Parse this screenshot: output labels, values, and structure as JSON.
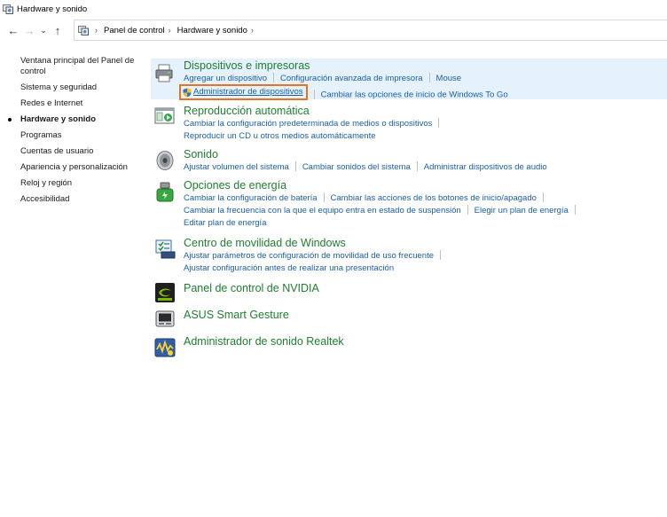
{
  "window": {
    "title": "Hardware y sonido"
  },
  "breadcrumb": [
    "Panel de control",
    "Hardware y sonido"
  ],
  "leftnav": {
    "items": [
      {
        "label": "Ventana principal del Panel de control",
        "current": false
      },
      {
        "label": "Sistema y seguridad",
        "current": false
      },
      {
        "label": "Redes e Internet",
        "current": false
      },
      {
        "label": "Hardware y sonido",
        "current": true
      },
      {
        "label": "Programas",
        "current": false
      },
      {
        "label": "Cuentas de usuario",
        "current": false
      },
      {
        "label": "Apariencia y personalización",
        "current": false
      },
      {
        "label": "Reloj y región",
        "current": false
      },
      {
        "label": "Accesibilidad",
        "current": false
      }
    ]
  },
  "categories": [
    {
      "title": "Dispositivos e impresoras",
      "icon": "printer-icon",
      "rows": [
        [
          "Agregar un dispositivo",
          "Configuración avanzada de impresora",
          "Mouse"
        ],
        [
          "Administrador de dispositivos",
          "Cambiar las opciones de inicio de Windows To Go"
        ]
      ]
    },
    {
      "title": "Reproducción automática",
      "icon": "autoplay-icon",
      "rows": [
        [
          "Cambiar la configuración predeterminada de medios o dispositivos"
        ],
        [
          "Reproducir un CD u otros medios automáticamente"
        ]
      ]
    },
    {
      "title": "Sonido",
      "icon": "speaker-icon",
      "rows": [
        [
          "Ajustar volumen del sistema",
          "Cambiar sonidos del sistema",
          "Administrar dispositivos de audio"
        ]
      ]
    },
    {
      "title": "Opciones de energía",
      "icon": "power-options-icon",
      "rows": [
        [
          "Cambiar la configuración de batería",
          "Cambiar las acciones de los botones de inicio/apagado"
        ],
        [
          "Cambiar la frecuencia con la que el equipo entra en estado de suspensión",
          "Elegir un plan de energía"
        ],
        [
          "Editar plan de energía"
        ]
      ]
    },
    {
      "title": "Centro de movilidad de Windows",
      "icon": "mobility-center-icon",
      "rows": [
        [
          "Ajustar parámetros de configuración de movilidad de uso frecuente"
        ],
        [
          "Ajustar configuración antes de realizar una presentación"
        ]
      ]
    },
    {
      "title": "Panel de control de NVIDIA",
      "icon": "nvidia-icon",
      "rows": []
    },
    {
      "title": "ASUS Smart Gesture",
      "icon": "touchpad-icon",
      "rows": []
    },
    {
      "title": "Administrador de sonido Realtek",
      "icon": "realtek-icon",
      "rows": []
    }
  ],
  "colors": {
    "category_title": "#1e7f2e",
    "link": "#1a5fa8",
    "highlight_bg": "#e5f1fb",
    "focus_box": "#e67322"
  }
}
